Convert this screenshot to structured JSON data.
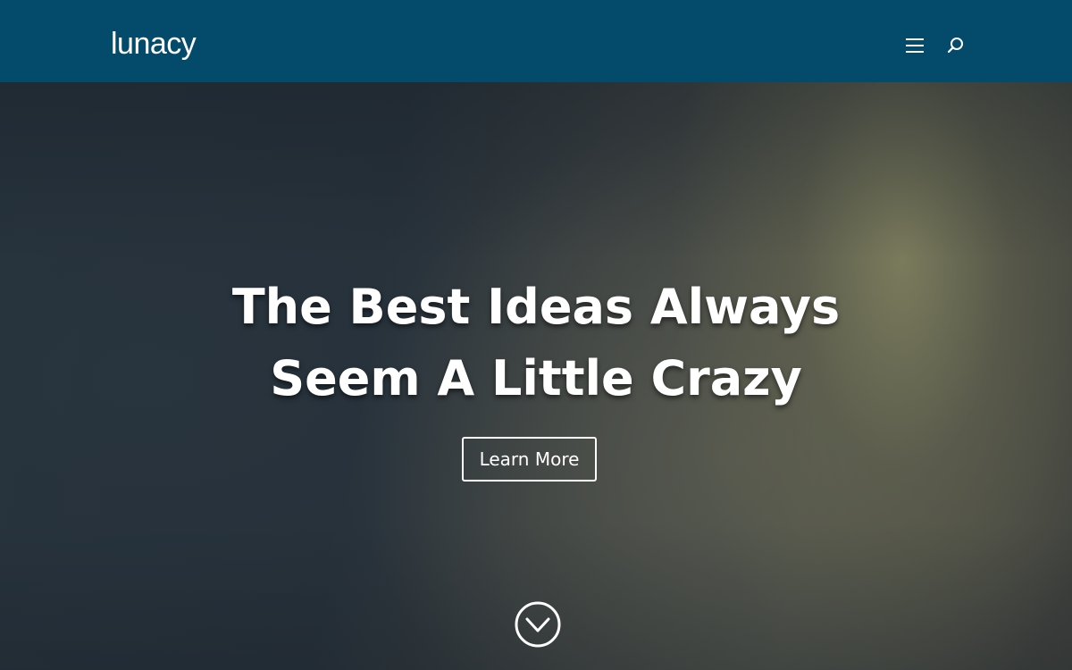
{
  "header": {
    "logo_text": "lunacy",
    "background_color": "#044a6b",
    "logo_arc_color": "#e0e38a",
    "menu_icon": "hamburger-menu-icon",
    "search_icon": "search-icon"
  },
  "hero": {
    "headline_line1": "The Best Ideas Always",
    "headline_line2": "Seem A Little Crazy",
    "button_label": "Learn More",
    "scroll_icon": "chevron-down-circle-icon"
  }
}
